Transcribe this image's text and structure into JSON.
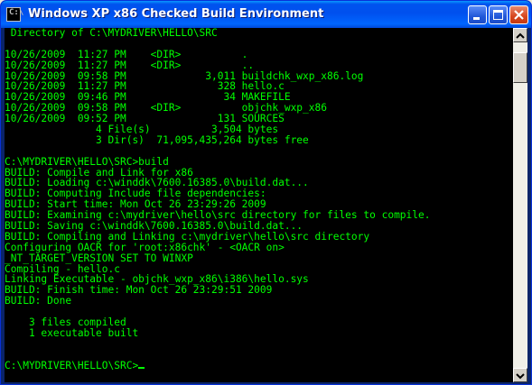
{
  "window": {
    "title": "Windows XP x86 Checked Build Environment",
    "minimize_label": "_",
    "maximize_label": "□",
    "close_label": "X"
  },
  "console": {
    "lines": [
      " Directory of C:\\MYDRIVER\\HELLO\\SRC",
      "",
      "10/26/2009  11:27 PM    <DIR>          .",
      "10/26/2009  11:27 PM    <DIR>          ..",
      "10/26/2009  09:58 PM             3,011 buildchk_wxp_x86.log",
      "10/26/2009  11:27 PM               328 hello.c",
      "10/26/2009  09:46 PM                34 MAKEFILE",
      "10/26/2009  09:58 PM    <DIR>          objchk_wxp_x86",
      "10/26/2009  09:52 PM               131 SOURCES",
      "               4 File(s)          3,504 bytes",
      "               3 Dir(s)  71,095,435,264 bytes free",
      "",
      "C:\\MYDRIVER\\HELLO\\SRC>build",
      "BUILD: Compile and Link for x86",
      "BUILD: Loading c:\\winddk\\7600.16385.0\\build.dat...",
      "BUILD: Computing Include file dependencies:",
      "BUILD: Start time: Mon Oct 26 23:29:26 2009",
      "BUILD: Examining c:\\mydriver\\hello\\src directory for files to compile.",
      "BUILD: Saving c:\\winddk\\7600.16385.0\\build.dat...",
      "BUILD: Compiling and Linking c:\\mydriver\\hello\\src directory",
      "Configuring OACR for 'root:x86chk' - <OACR on>",
      "_NT_TARGET_VERSION SET TO WINXP",
      "Compiling - hello.c",
      "Linking Executable - objchk_wxp_x86\\i386\\hello.sys",
      "BUILD: Finish time: Mon Oct 26 23:29:51 2009",
      "BUILD: Done",
      "",
      "    3 files compiled",
      "    1 executable built",
      "",
      ""
    ],
    "prompt": "C:\\MYDRIVER\\HELLO\\SRC>",
    "text_color": "#00ff00",
    "background_color": "#000000"
  },
  "icons": {
    "app": "console-icon",
    "minimize": "minimize-icon",
    "maximize": "maximize-icon",
    "close": "close-icon",
    "scroll_up": "chevron-up-icon",
    "scroll_down": "chevron-down-icon"
  }
}
